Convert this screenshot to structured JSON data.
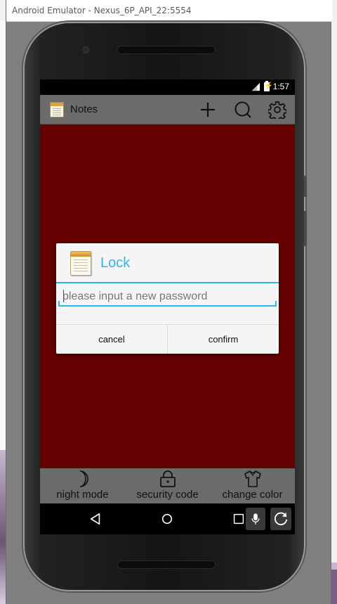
{
  "emulator": {
    "window_title": "Android Emulator - Nexus_6P_API_22:5554"
  },
  "statusbar": {
    "time": "1:57",
    "icons": [
      "signal-icon",
      "battery-icon"
    ]
  },
  "appbar": {
    "title": "Notes",
    "actions": [
      {
        "name": "add",
        "icon": "plus-icon"
      },
      {
        "name": "search",
        "icon": "search-icon"
      },
      {
        "name": "settings",
        "icon": "gear-icon"
      }
    ]
  },
  "colors": {
    "content_background": "#640000",
    "accent": "#33b5e5",
    "bar_background": "#6b6b6b"
  },
  "dialog": {
    "title": "Lock",
    "password_placeholder": "please input a new password",
    "password_value": "",
    "cancel_label": "cancel",
    "confirm_label": "confirm"
  },
  "bottom_bar": {
    "items": [
      {
        "label": "night mode",
        "icon": "moon-icon"
      },
      {
        "label": "security code",
        "icon": "lock-icon"
      },
      {
        "label": "change color",
        "icon": "shirt-icon"
      }
    ]
  },
  "navbar": {
    "buttons": [
      "back-icon",
      "home-icon",
      "recents-icon",
      "microphone-icon",
      "rotate-icon"
    ]
  }
}
